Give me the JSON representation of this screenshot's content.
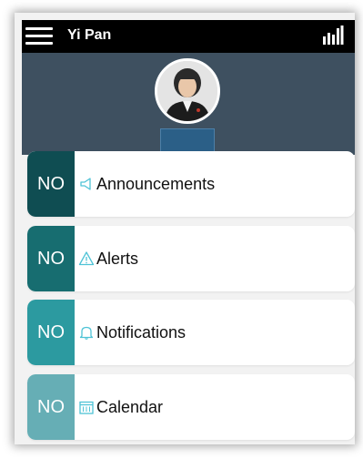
{
  "header": {
    "title": "Yi Pan",
    "menu_icon": "hamburger-menu-icon",
    "stats_icon": "bar-chart-icon"
  },
  "profile": {
    "name_label": ""
  },
  "items": [
    {
      "badge": "NO",
      "label": "Announcements",
      "icon": "megaphone-icon",
      "badge_color": "#0f4d52"
    },
    {
      "badge": "NO",
      "label": "Alerts",
      "icon": "warning-icon",
      "badge_color": "#176d70"
    },
    {
      "badge": "NO",
      "label": "Notifications",
      "icon": "bell-icon",
      "badge_color": "#2c9aa0"
    },
    {
      "badge": "NO",
      "label": "Calendar",
      "icon": "calendar-icon",
      "badge_color": "#66aeb5"
    }
  ],
  "colors": {
    "topbar": "#000000",
    "profile_bg": "#3e5060",
    "icon_accent": "#4fc3d6"
  }
}
